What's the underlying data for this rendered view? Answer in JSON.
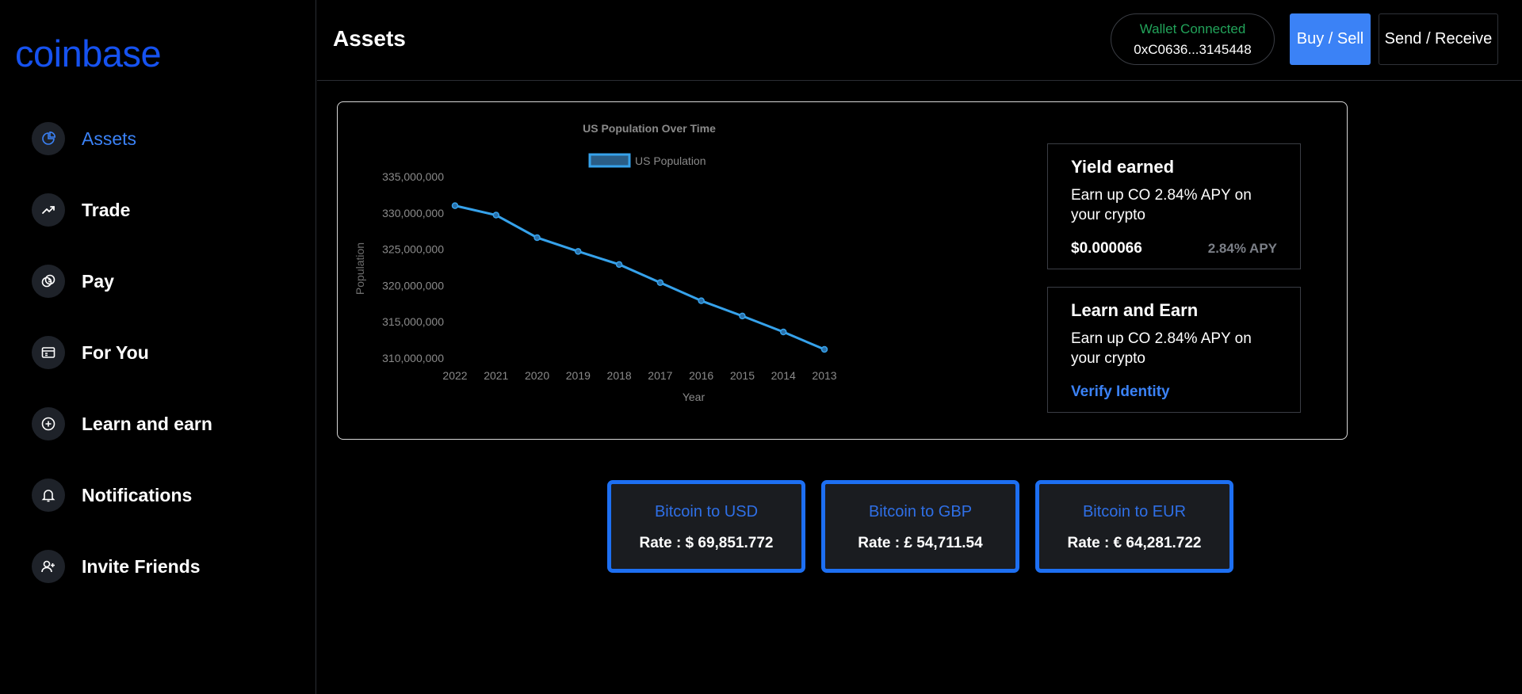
{
  "brand": {
    "logo_text": "coinbase",
    "accent": "#1652f0",
    "link_color": "#3b82f6"
  },
  "sidebar": {
    "items": [
      {
        "label": "Assets",
        "icon": "pie-chart-icon",
        "active": true
      },
      {
        "label": "Trade",
        "icon": "trend-up-icon"
      },
      {
        "label": "Pay",
        "icon": "coins-icon"
      },
      {
        "label": "For You",
        "icon": "browser-window-icon"
      },
      {
        "label": "Learn and earn",
        "icon": "plus-circle-icon"
      },
      {
        "label": "Notifications",
        "icon": "bell-icon"
      },
      {
        "label": "Invite Friends",
        "icon": "user-plus-icon"
      }
    ]
  },
  "header": {
    "title": "Assets",
    "wallet_status": "Wallet Connected",
    "wallet_address": "0xC0636...3145448",
    "buy_label": "Buy / Sell",
    "send_label": "Send / Receive"
  },
  "chart_data": {
    "type": "line",
    "title": "US Population Over Time",
    "xlabel": "Year",
    "ylabel": "Population",
    "categories": [
      "2022",
      "2021",
      "2020",
      "2019",
      "2018",
      "2017",
      "2016",
      "2015",
      "2014",
      "2013"
    ],
    "series": [
      {
        "name": "US Population",
        "values": [
          331000000,
          329700000,
          326600000,
          324700000,
          322900000,
          320400000,
          317900000,
          315800000,
          313600000,
          311200000
        ],
        "color": "#36a2eb"
      }
    ],
    "yticks": [
      310000000,
      315000000,
      320000000,
      325000000,
      330000000,
      335000000
    ],
    "ytick_labels": [
      "310,000,000",
      "315,000,000",
      "320,000,000",
      "325,000,000",
      "330,000,000",
      "335,000,000"
    ],
    "ylim": [
      310000000,
      335000000
    ],
    "legend": "top-center",
    "grid": false
  },
  "cards": {
    "yield": {
      "title": "Yield earned",
      "desc": "Earn up CO 2.84% APY on your crypto",
      "amount": "$0.000066",
      "apy": "2.84% APY"
    },
    "learn": {
      "title": "Learn and Earn",
      "desc": "Earn up CO 2.84% APY on your crypto",
      "link": "Verify Identity"
    }
  },
  "rates": [
    {
      "title": "Bitcoin to USD",
      "value": "Rate : $ 69,851.772"
    },
    {
      "title": "Bitcoin to GBP",
      "value": "Rate : £ 54,711.54"
    },
    {
      "title": "Bitcoin to EUR",
      "value": "Rate : € 64,281.722"
    }
  ]
}
